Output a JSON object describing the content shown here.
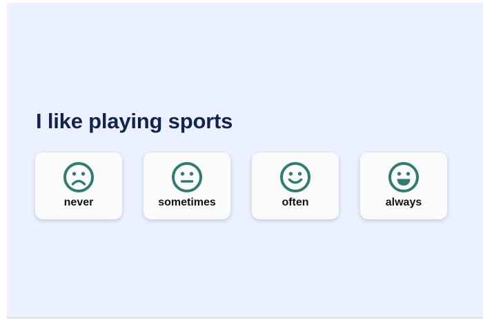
{
  "question": {
    "title": "I like playing sports"
  },
  "options": [
    {
      "label": "never",
      "icon": "sad-face-icon"
    },
    {
      "label": "sometimes",
      "icon": "neutral-face-icon"
    },
    {
      "label": "often",
      "icon": "smiling-face-icon"
    },
    {
      "label": "always",
      "icon": "grinning-face-icon"
    }
  ],
  "colors": {
    "background": "#ebf1fe",
    "title": "#12244e",
    "icon": "#2f7d6e",
    "card": "#fbfbfb"
  }
}
